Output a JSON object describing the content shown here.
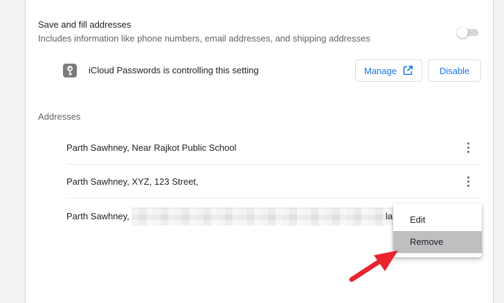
{
  "setting": {
    "title": "Save and fill addresses",
    "subtitle": "Includes information like phone numbers, email addresses, and shipping addresses",
    "toggle_on": false
  },
  "managed": {
    "icon": "key-icon",
    "text": "iCloud Passwords is controlling this setting",
    "manage_label": "Manage",
    "manage_icon": "open-in-new-icon",
    "disable_label": "Disable"
  },
  "addresses": {
    "title": "Addresses",
    "items": [
      {
        "text": "Parth Sawhney, Near Rajkot Public School"
      },
      {
        "text": "Parth Sawhney, XYZ, 123 Street,"
      },
      {
        "text": "Parth Sawhney,",
        "tail": "la"
      }
    ]
  },
  "context_menu": {
    "edit_label": "Edit",
    "remove_label": "Remove"
  },
  "colors": {
    "accent": "#1a73e8",
    "annotation_arrow": "#e8242f"
  }
}
